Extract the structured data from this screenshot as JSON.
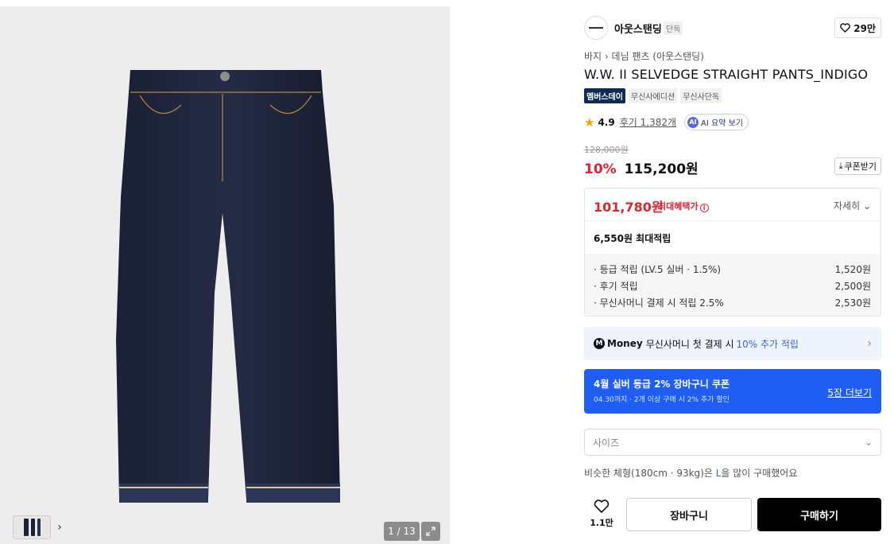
{
  "gallery": {
    "counter": "1 / 13",
    "image_alt": "jeans-product-photo"
  },
  "brand": {
    "name": "아웃스탠딩",
    "tag": "단독",
    "likes": "29만"
  },
  "breadcrumb": [
    "바지",
    "데님 팬츠 (아웃스탠딩)"
  ],
  "product": {
    "title": "W.W. II SELVEDGE STRAIGHT PANTS_INDIGO",
    "badges": [
      "멤버스데이",
      "무신사에디션",
      "무신사단독"
    ],
    "rating": "4.9",
    "reviews": "후기 1,382개",
    "ai_summary": "AI 요약 보기"
  },
  "price": {
    "original": "128,000원",
    "discount": "10%",
    "sale": "115,200원",
    "coupon_button": "쿠폰받기"
  },
  "benefits": {
    "max_price": "101,780원",
    "max_label": "최대혜택가",
    "detail_toggle": "자세히",
    "point_total": "6,550원 최대적립",
    "points": [
      {
        "label": "· 등급 적립 (LV.5 실버 · 1.5%)",
        "value": "1,520원"
      },
      {
        "label": "· 후기 적립",
        "value": "2,500원"
      },
      {
        "label": "· 무신사머니 결제 시 적립 2.5%",
        "value": "2,530원"
      }
    ]
  },
  "money_banner": {
    "brand": "Money",
    "text": "무신사머니 첫 결제 시",
    "accent": "10% 추가 적립"
  },
  "coupon_banner": {
    "title": "4월 실버 등급 2% 장바구니 쿠폰",
    "subtitle": "04.30까지 · 2개 이상 구매 시 2% 추가 할인",
    "more": "5장 더보기"
  },
  "size_select": {
    "placeholder": "사이즈"
  },
  "similar": {
    "prefix": "비슷한 체형(180cm · 93kg)은 ",
    "highlight": "L",
    "suffix": "을 많이 구매했어요"
  },
  "actions": {
    "wish_count": "1.1만",
    "cart": "장바구니",
    "buy": "구매하기"
  },
  "colors": {
    "discount_red": "#e2222e",
    "coupon_blue": "#1f5ef5",
    "denim_indigo": "#1c2236"
  }
}
